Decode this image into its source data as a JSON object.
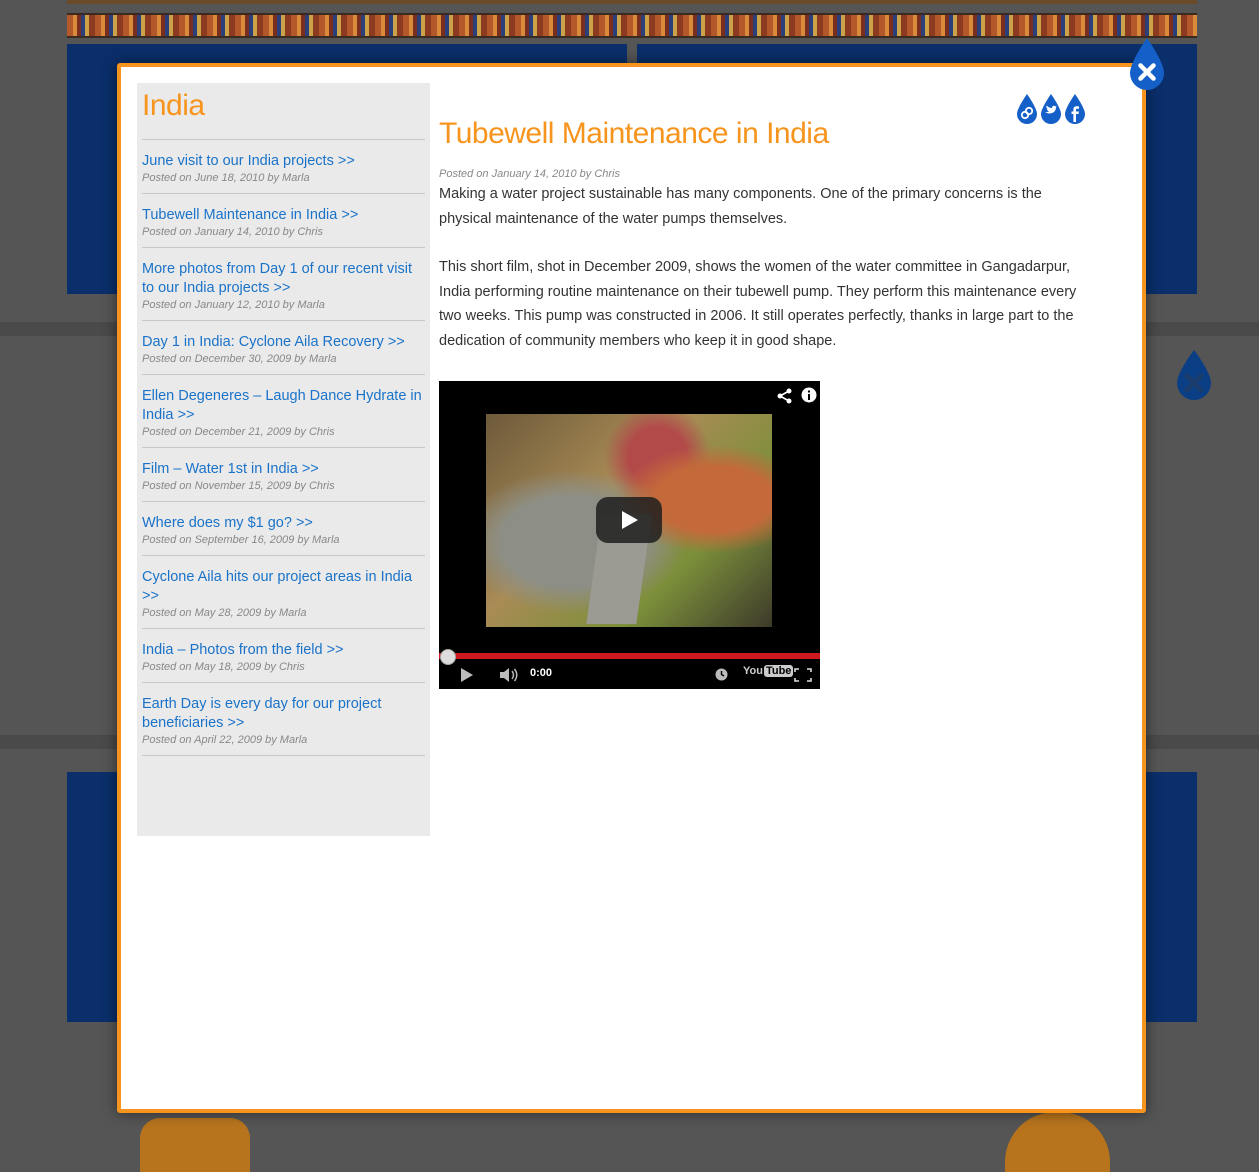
{
  "colors": {
    "accent": "#f7941d",
    "link": "#1a73c9",
    "drop": "#1560c8"
  },
  "sidebar": {
    "title": "India",
    "posts": [
      {
        "title": "June visit to our India projects >>",
        "meta": "Posted on June 18, 2010 by Marla"
      },
      {
        "title": "Tubewell Maintenance in India >>",
        "meta": "Posted on January 14, 2010 by Chris"
      },
      {
        "title": "More photos from Day 1 of our recent visit to our India projects >>",
        "meta": "Posted on January 12, 2010 by Marla"
      },
      {
        "title": "Day 1 in India: Cyclone Aila Recovery >>",
        "meta": "Posted on December 30, 2009 by Marla"
      },
      {
        "title": "Ellen Degeneres – Laugh Dance Hydrate in India >>",
        "meta": "Posted on December 21, 2009 by Chris"
      },
      {
        "title": "Film – Water 1st in India >>",
        "meta": "Posted on November 15, 2009 by Chris"
      },
      {
        "title": "Where does my $1 go? >>",
        "meta": "Posted on September 16, 2009 by Marla"
      },
      {
        "title": "Cyclone Aila hits our project areas in India >>",
        "meta": "Posted on May 28, 2009 by Marla"
      },
      {
        "title": "India – Photos from the field >>",
        "meta": "Posted on May 18, 2009 by Chris"
      },
      {
        "title": "Earth Day is every day for our project beneficiaries >>",
        "meta": "Posted on April 22, 2009 by Marla"
      }
    ]
  },
  "article": {
    "title": "Tubewell Maintenance in India",
    "meta": "Posted on January 14, 2010 by Chris",
    "paragraphs": [
      "Making a water project sustainable has many components. One of the primary concerns is the physical maintenance of the water pumps themselves.",
      "This short film, shot in December 2009, shows the women of the water committee in Gangadarpur, India performing routine maintenance on their tubewell pump. They perform this maintenance every two weeks. This pump was constructed in 2006. It still operates perfectly, thanks in large part to the dedication of community members who keep it in good shape."
    ]
  },
  "share_icons": [
    "link-icon",
    "twitter-icon",
    "facebook-icon"
  ],
  "video": {
    "time": "0:00",
    "brand_you": "You",
    "brand_tube": "Tube",
    "progress": 0
  }
}
